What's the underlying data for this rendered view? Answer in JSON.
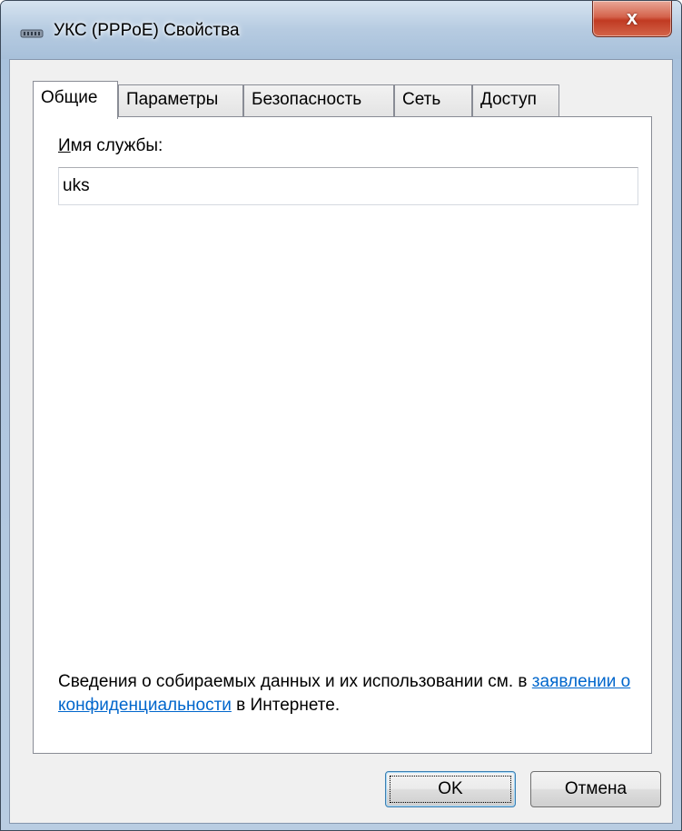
{
  "window": {
    "title": "УКС (PPPoE) Свойства",
    "close_symbol": "x",
    "icon": "network-connection-icon"
  },
  "tabs": [
    {
      "label": "Общие",
      "active": true
    },
    {
      "label": "Параметры",
      "active": false
    },
    {
      "label": "Безопасность",
      "active": false
    },
    {
      "label": "Сеть",
      "active": false
    },
    {
      "label": "Доступ",
      "active": false
    }
  ],
  "general": {
    "service_label_mnemonic": "И",
    "service_label_rest": "мя службы:",
    "service_value": "uks",
    "privacy_text_before": "Сведения о собираемых данных и их использовании см. в ",
    "privacy_link": "заявлении о конфиденциальности",
    "privacy_text_after": " в Интернете."
  },
  "buttons": {
    "ok": "OK",
    "cancel": "Отмена"
  },
  "colors": {
    "link": "#0066cc",
    "close_button": "#c13a22",
    "dialog_bg": "#f0f0f0"
  }
}
